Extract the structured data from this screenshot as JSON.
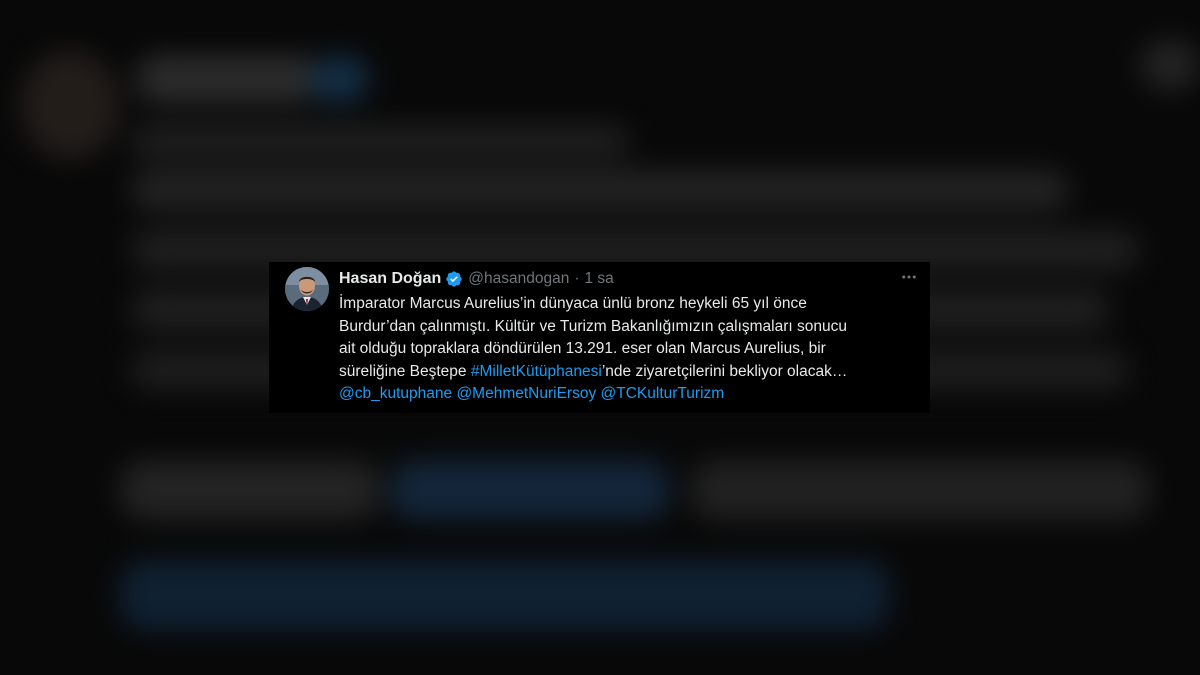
{
  "tweet": {
    "author_name": "Hasan Doğan",
    "handle": "@hasandogan",
    "separator": "·",
    "time": "1 sa",
    "more_icon": "more-horizontal-icon",
    "verified_icon": "verified-badge-icon",
    "text": {
      "line1": "İmparator Marcus Aurelius’in dünyaca ünlü bronz heykeli 65 yıl önce",
      "line2": "Burdur’dan çalınmıştı. Kültür ve Turizm Bakanlığımızın çalışmaları sonucu",
      "line3": "ait olduğu topraklara döndürülen 13.291. eser olan Marcus Aurelius, bir",
      "line4_pre": "süreliğine Beştepe ",
      "hashtag": "#MilletKütüphanesi",
      "line4_post": "’nde ziyaretçilerini bekliyor olacak…",
      "mentions": [
        "@cb_kutuphane",
        "@MehmetNuriErsoy",
        "@TCKulturTurizm"
      ]
    }
  },
  "colors": {
    "background": "#000000",
    "text": "#e7e9ea",
    "secondary": "#71767b",
    "link": "#1d9bf0",
    "verified": "#1d9bf0"
  }
}
